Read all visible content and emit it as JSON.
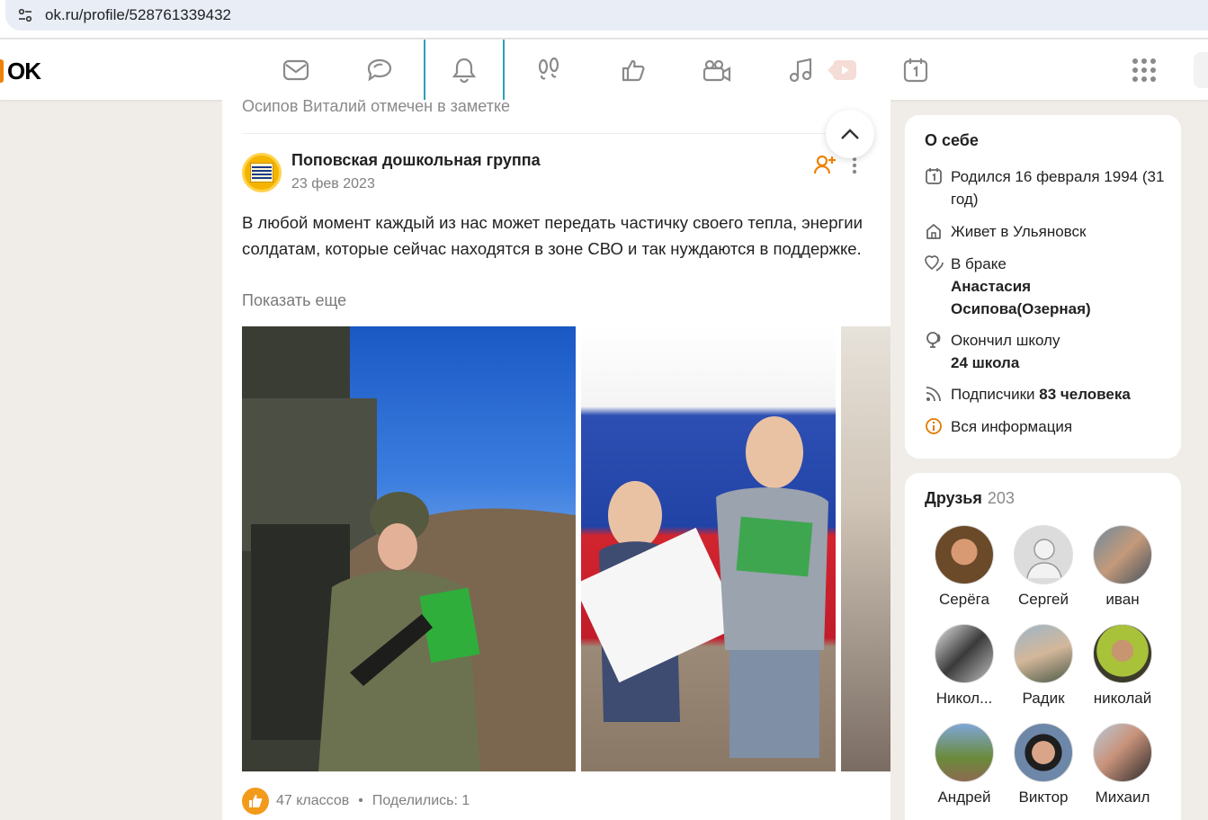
{
  "browser": {
    "url": "ok.ru/profile/528761339432"
  },
  "nav": {
    "logo": "OK"
  },
  "feed": {
    "noted_text": "Осипов Виталий отмечен в заметке",
    "post": {
      "group_name": "Поповская дошкольная группа",
      "date": "23 фев 2023",
      "text": "В любой момент каждый из нас может передать частичку своего тепла, энергии солдатам, которые сейчас находятся в зоне СВО и так нуждаются в поддержке.",
      "show_more": "Показать еще",
      "likes": "47 классов",
      "dot": "•",
      "shares": "Поделились: 1"
    }
  },
  "about": {
    "title": "О себе",
    "born": "Родился 16 февраля 1994 (31 год)",
    "lives": "Живет в Ульяновск",
    "married_label": "В браке",
    "spouse": "Анастасия Осипова(Озерная)",
    "school_label": "Окончил школу",
    "school": "24 школа",
    "subs_label": "Подписчики",
    "subs_count": "83 человека",
    "all_info": "Вся информация"
  },
  "friends": {
    "title": "Друзья",
    "count": "203",
    "list": [
      {
        "name": "Серёга"
      },
      {
        "name": "Сергей"
      },
      {
        "name": "иван"
      },
      {
        "name": "Никол..."
      },
      {
        "name": "Радик"
      },
      {
        "name": "николай"
      },
      {
        "name": "Андрей"
      },
      {
        "name": "Виктор"
      },
      {
        "name": "Михаил"
      }
    ]
  },
  "colors": {
    "accent": "#ee8208",
    "active_tab": "#2f9fb7"
  }
}
